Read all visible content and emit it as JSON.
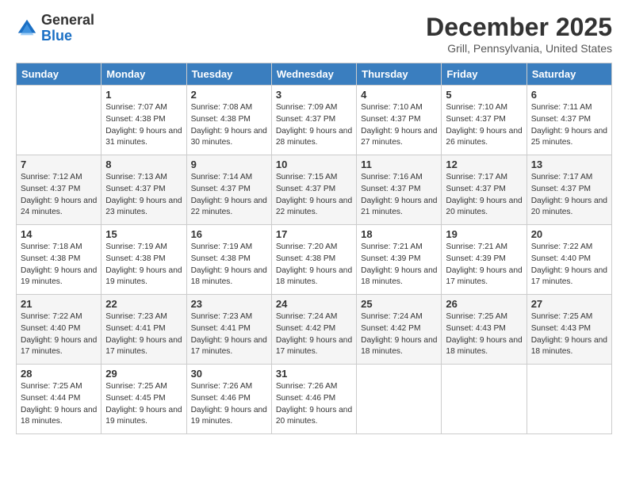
{
  "logo": {
    "general": "General",
    "blue": "Blue"
  },
  "title": "December 2025",
  "subtitle": "Grill, Pennsylvania, United States",
  "days_of_week": [
    "Sunday",
    "Monday",
    "Tuesday",
    "Wednesday",
    "Thursday",
    "Friday",
    "Saturday"
  ],
  "weeks": [
    [
      {
        "day": "",
        "sunrise": "",
        "sunset": "",
        "daylight": ""
      },
      {
        "day": "1",
        "sunrise": "Sunrise: 7:07 AM",
        "sunset": "Sunset: 4:38 PM",
        "daylight": "Daylight: 9 hours and 31 minutes."
      },
      {
        "day": "2",
        "sunrise": "Sunrise: 7:08 AM",
        "sunset": "Sunset: 4:38 PM",
        "daylight": "Daylight: 9 hours and 30 minutes."
      },
      {
        "day": "3",
        "sunrise": "Sunrise: 7:09 AM",
        "sunset": "Sunset: 4:37 PM",
        "daylight": "Daylight: 9 hours and 28 minutes."
      },
      {
        "day": "4",
        "sunrise": "Sunrise: 7:10 AM",
        "sunset": "Sunset: 4:37 PM",
        "daylight": "Daylight: 9 hours and 27 minutes."
      },
      {
        "day": "5",
        "sunrise": "Sunrise: 7:10 AM",
        "sunset": "Sunset: 4:37 PM",
        "daylight": "Daylight: 9 hours and 26 minutes."
      },
      {
        "day": "6",
        "sunrise": "Sunrise: 7:11 AM",
        "sunset": "Sunset: 4:37 PM",
        "daylight": "Daylight: 9 hours and 25 minutes."
      }
    ],
    [
      {
        "day": "7",
        "sunrise": "Sunrise: 7:12 AM",
        "sunset": "Sunset: 4:37 PM",
        "daylight": "Daylight: 9 hours and 24 minutes."
      },
      {
        "day": "8",
        "sunrise": "Sunrise: 7:13 AM",
        "sunset": "Sunset: 4:37 PM",
        "daylight": "Daylight: 9 hours and 23 minutes."
      },
      {
        "day": "9",
        "sunrise": "Sunrise: 7:14 AM",
        "sunset": "Sunset: 4:37 PM",
        "daylight": "Daylight: 9 hours and 22 minutes."
      },
      {
        "day": "10",
        "sunrise": "Sunrise: 7:15 AM",
        "sunset": "Sunset: 4:37 PM",
        "daylight": "Daylight: 9 hours and 22 minutes."
      },
      {
        "day": "11",
        "sunrise": "Sunrise: 7:16 AM",
        "sunset": "Sunset: 4:37 PM",
        "daylight": "Daylight: 9 hours and 21 minutes."
      },
      {
        "day": "12",
        "sunrise": "Sunrise: 7:17 AM",
        "sunset": "Sunset: 4:37 PM",
        "daylight": "Daylight: 9 hours and 20 minutes."
      },
      {
        "day": "13",
        "sunrise": "Sunrise: 7:17 AM",
        "sunset": "Sunset: 4:37 PM",
        "daylight": "Daylight: 9 hours and 20 minutes."
      }
    ],
    [
      {
        "day": "14",
        "sunrise": "Sunrise: 7:18 AM",
        "sunset": "Sunset: 4:38 PM",
        "daylight": "Daylight: 9 hours and 19 minutes."
      },
      {
        "day": "15",
        "sunrise": "Sunrise: 7:19 AM",
        "sunset": "Sunset: 4:38 PM",
        "daylight": "Daylight: 9 hours and 19 minutes."
      },
      {
        "day": "16",
        "sunrise": "Sunrise: 7:19 AM",
        "sunset": "Sunset: 4:38 PM",
        "daylight": "Daylight: 9 hours and 18 minutes."
      },
      {
        "day": "17",
        "sunrise": "Sunrise: 7:20 AM",
        "sunset": "Sunset: 4:38 PM",
        "daylight": "Daylight: 9 hours and 18 minutes."
      },
      {
        "day": "18",
        "sunrise": "Sunrise: 7:21 AM",
        "sunset": "Sunset: 4:39 PM",
        "daylight": "Daylight: 9 hours and 18 minutes."
      },
      {
        "day": "19",
        "sunrise": "Sunrise: 7:21 AM",
        "sunset": "Sunset: 4:39 PM",
        "daylight": "Daylight: 9 hours and 17 minutes."
      },
      {
        "day": "20",
        "sunrise": "Sunrise: 7:22 AM",
        "sunset": "Sunset: 4:40 PM",
        "daylight": "Daylight: 9 hours and 17 minutes."
      }
    ],
    [
      {
        "day": "21",
        "sunrise": "Sunrise: 7:22 AM",
        "sunset": "Sunset: 4:40 PM",
        "daylight": "Daylight: 9 hours and 17 minutes."
      },
      {
        "day": "22",
        "sunrise": "Sunrise: 7:23 AM",
        "sunset": "Sunset: 4:41 PM",
        "daylight": "Daylight: 9 hours and 17 minutes."
      },
      {
        "day": "23",
        "sunrise": "Sunrise: 7:23 AM",
        "sunset": "Sunset: 4:41 PM",
        "daylight": "Daylight: 9 hours and 17 minutes."
      },
      {
        "day": "24",
        "sunrise": "Sunrise: 7:24 AM",
        "sunset": "Sunset: 4:42 PM",
        "daylight": "Daylight: 9 hours and 17 minutes."
      },
      {
        "day": "25",
        "sunrise": "Sunrise: 7:24 AM",
        "sunset": "Sunset: 4:42 PM",
        "daylight": "Daylight: 9 hours and 18 minutes."
      },
      {
        "day": "26",
        "sunrise": "Sunrise: 7:25 AM",
        "sunset": "Sunset: 4:43 PM",
        "daylight": "Daylight: 9 hours and 18 minutes."
      },
      {
        "day": "27",
        "sunrise": "Sunrise: 7:25 AM",
        "sunset": "Sunset: 4:43 PM",
        "daylight": "Daylight: 9 hours and 18 minutes."
      }
    ],
    [
      {
        "day": "28",
        "sunrise": "Sunrise: 7:25 AM",
        "sunset": "Sunset: 4:44 PM",
        "daylight": "Daylight: 9 hours and 18 minutes."
      },
      {
        "day": "29",
        "sunrise": "Sunrise: 7:25 AM",
        "sunset": "Sunset: 4:45 PM",
        "daylight": "Daylight: 9 hours and 19 minutes."
      },
      {
        "day": "30",
        "sunrise": "Sunrise: 7:26 AM",
        "sunset": "Sunset: 4:46 PM",
        "daylight": "Daylight: 9 hours and 19 minutes."
      },
      {
        "day": "31",
        "sunrise": "Sunrise: 7:26 AM",
        "sunset": "Sunset: 4:46 PM",
        "daylight": "Daylight: 9 hours and 20 minutes."
      },
      {
        "day": "",
        "sunrise": "",
        "sunset": "",
        "daylight": ""
      },
      {
        "day": "",
        "sunrise": "",
        "sunset": "",
        "daylight": ""
      },
      {
        "day": "",
        "sunrise": "",
        "sunset": "",
        "daylight": ""
      }
    ]
  ]
}
